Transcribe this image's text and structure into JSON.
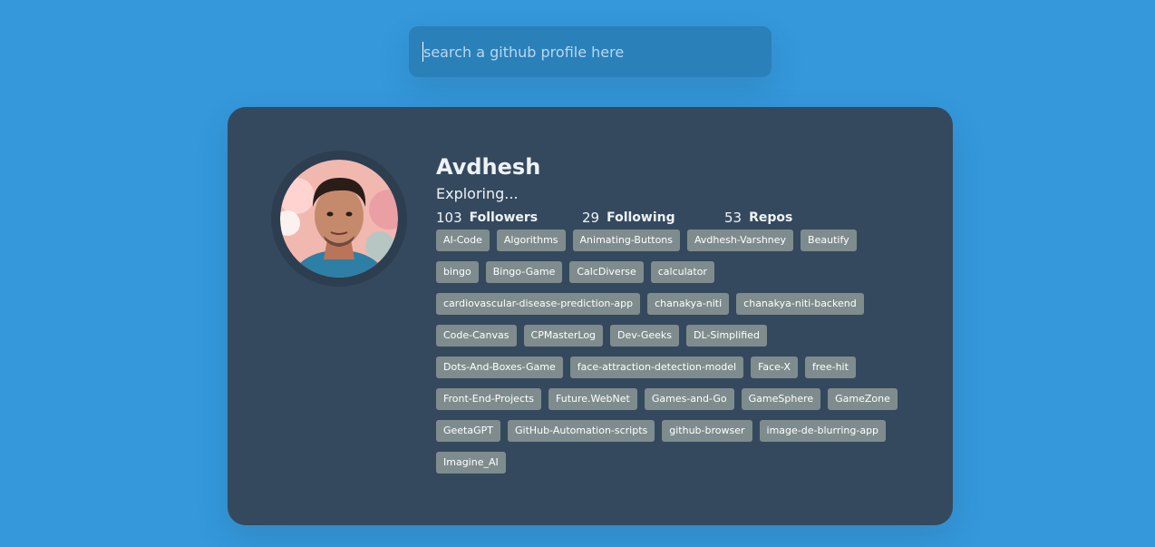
{
  "search": {
    "placeholder": "search a github profile here",
    "value": ""
  },
  "profile": {
    "name": "Avdhesh",
    "bio": "Exploring...",
    "followers_count": "103",
    "followers_label": "Followers",
    "following_count": "29",
    "following_label": "Following",
    "repos_count": "53",
    "repos_label": "Repos"
  },
  "repos": [
    "AI-Code",
    "Algorithms",
    "Animating-Buttons",
    "Avdhesh-Varshney",
    "Beautify",
    "bingo",
    "Bingo-Game",
    "CalcDiverse",
    "calculator",
    "cardiovascular-disease-prediction-app",
    "chanakya-niti",
    "chanakya-niti-backend",
    "Code-Canvas",
    "CPMasterLog",
    "Dev-Geeks",
    "DL-Simplified",
    "Dots-And-Boxes-Game",
    "face-attraction-detection-model",
    "Face-X",
    "free-hit",
    "Front-End-Projects",
    "Future.WebNet",
    "Games-and-Go",
    "GameSphere",
    "GameZone",
    "GeetaGPT",
    "GitHub-Automation-scripts",
    "github-browser",
    "image-de-blurring-app",
    "Imagine_AI"
  ],
  "colors": {
    "background": "#3498db",
    "card": "#34495e",
    "search_bg": "#2a80b9",
    "repo_tag": "#7f8c8d"
  }
}
